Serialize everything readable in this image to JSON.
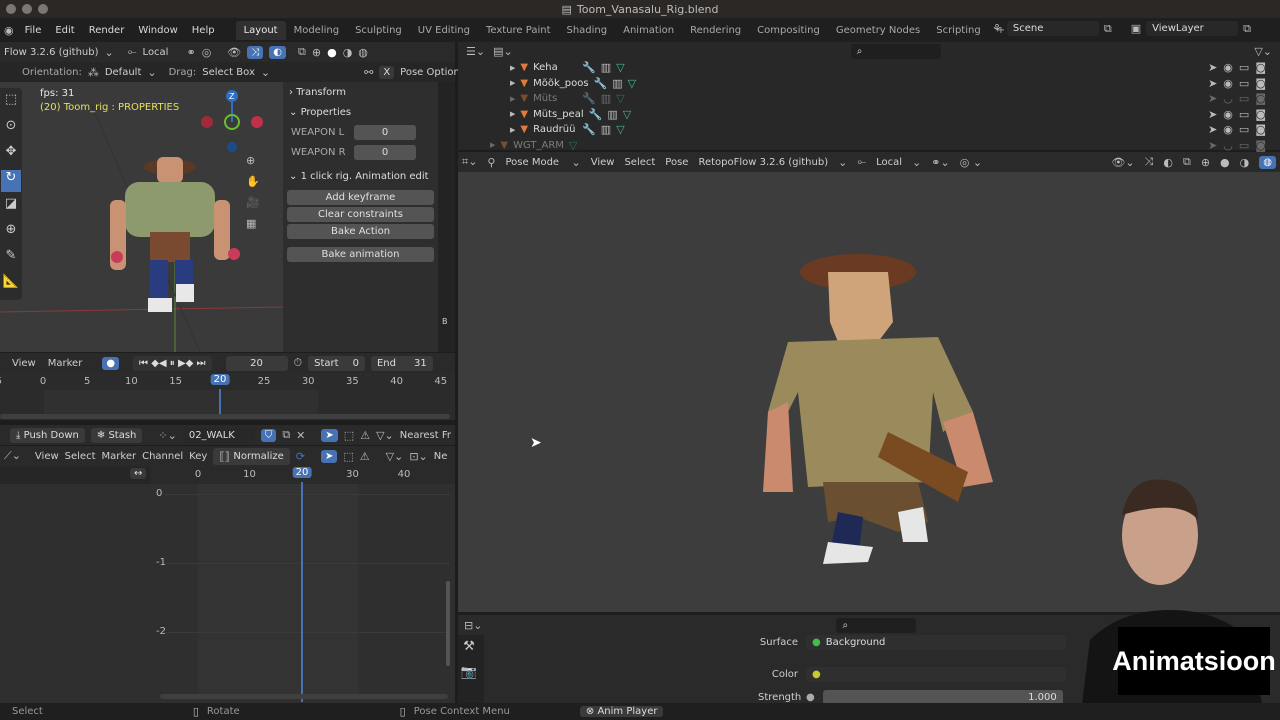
{
  "window": {
    "title": "Toom_Vanasalu_Rig.blend"
  },
  "menu": [
    "File",
    "Edit",
    "Render",
    "Window",
    "Help"
  ],
  "workspaces": [
    "Layout",
    "Modeling",
    "Sculpting",
    "UV Editing",
    "Texture Paint",
    "Shading",
    "Animation",
    "Rendering",
    "Compositing",
    "Geometry Nodes",
    "Scripting",
    "+"
  ],
  "active_workspace": "Layout",
  "scene": {
    "scene_name": "Scene",
    "view_layer": "ViewLayer"
  },
  "left_viewport": {
    "header": {
      "addon": "Flow 3.2.6 (github)",
      "pivot": "Local",
      "orientation_label": "Orientation:",
      "orientation": "Default",
      "drag_label": "Drag:",
      "drag": "Select Box",
      "pose_options": "Pose Options",
      "x": "X"
    },
    "overlay": {
      "fps": "fps: 31",
      "object": "(20) Toom_rig : PROPERTIES"
    },
    "gizmo": {
      "z": "Z"
    },
    "npanel": {
      "transform": "Transform",
      "properties": "Properties",
      "props": [
        {
          "label": "WEAPON L",
          "value": "0"
        },
        {
          "label": "WEAPON R",
          "value": "0"
        }
      ],
      "section": "1 click rig. Animation edit",
      "buttons": [
        "Add keyframe",
        "Clear constraints",
        "Bake Action",
        "Bake animation"
      ]
    },
    "side_tabs": [
      "B"
    ]
  },
  "timeline": {
    "menus": [
      "View",
      "Marker"
    ],
    "current_frame": "20",
    "start_label": "Start",
    "start": "0",
    "end_label": "End",
    "end": "31",
    "ticks": [
      "5",
      "0",
      "5",
      "10",
      "15",
      "20",
      "25",
      "30",
      "35",
      "40",
      "45"
    ]
  },
  "action_editor": {
    "push_down": "Push Down",
    "stash": "Stash",
    "action": "02_WALK",
    "interpolation": "Nearest Fr"
  },
  "graph_editor": {
    "menus": [
      "View",
      "Select",
      "Marker",
      "Channel",
      "Key"
    ],
    "normalize": "Normalize",
    "extra": "Ne",
    "ticks": [
      "0",
      "10",
      "20",
      "30",
      "40"
    ],
    "current_frame": "20",
    "y_ticks": [
      "0",
      "-1",
      "-2"
    ]
  },
  "outliner": {
    "items": [
      {
        "name": "Keha",
        "dim": false
      },
      {
        "name": "Mõõk_poos",
        "dim": false
      },
      {
        "name": "Müts",
        "dim": true
      },
      {
        "name": "Müts_peal",
        "dim": false
      },
      {
        "name": "Raudrüü",
        "dim": false
      },
      {
        "name": "WGT_ARM",
        "dim": true
      }
    ]
  },
  "main_viewport": {
    "mode": "Pose Mode",
    "menus": [
      "View",
      "Select",
      "Pose"
    ],
    "addon": "RetopoFlow 3.2.6 (github)",
    "pivot": "Local"
  },
  "properties": {
    "surface_label": "Surface",
    "surface": "Background",
    "color_label": "Color",
    "strength_label": "Strength",
    "strength": "1.000"
  },
  "watermark": "Animatsioon",
  "statusbar": {
    "select": "Select",
    "rotate": "Rotate",
    "context_menu": "Pose Context Menu",
    "anim_player": "Anim Player"
  },
  "colors": {
    "accent": "#4772b3",
    "mesh": "#e07b39",
    "socket_green": "#3fbf4a",
    "socket_yellow": "#c8c832"
  }
}
